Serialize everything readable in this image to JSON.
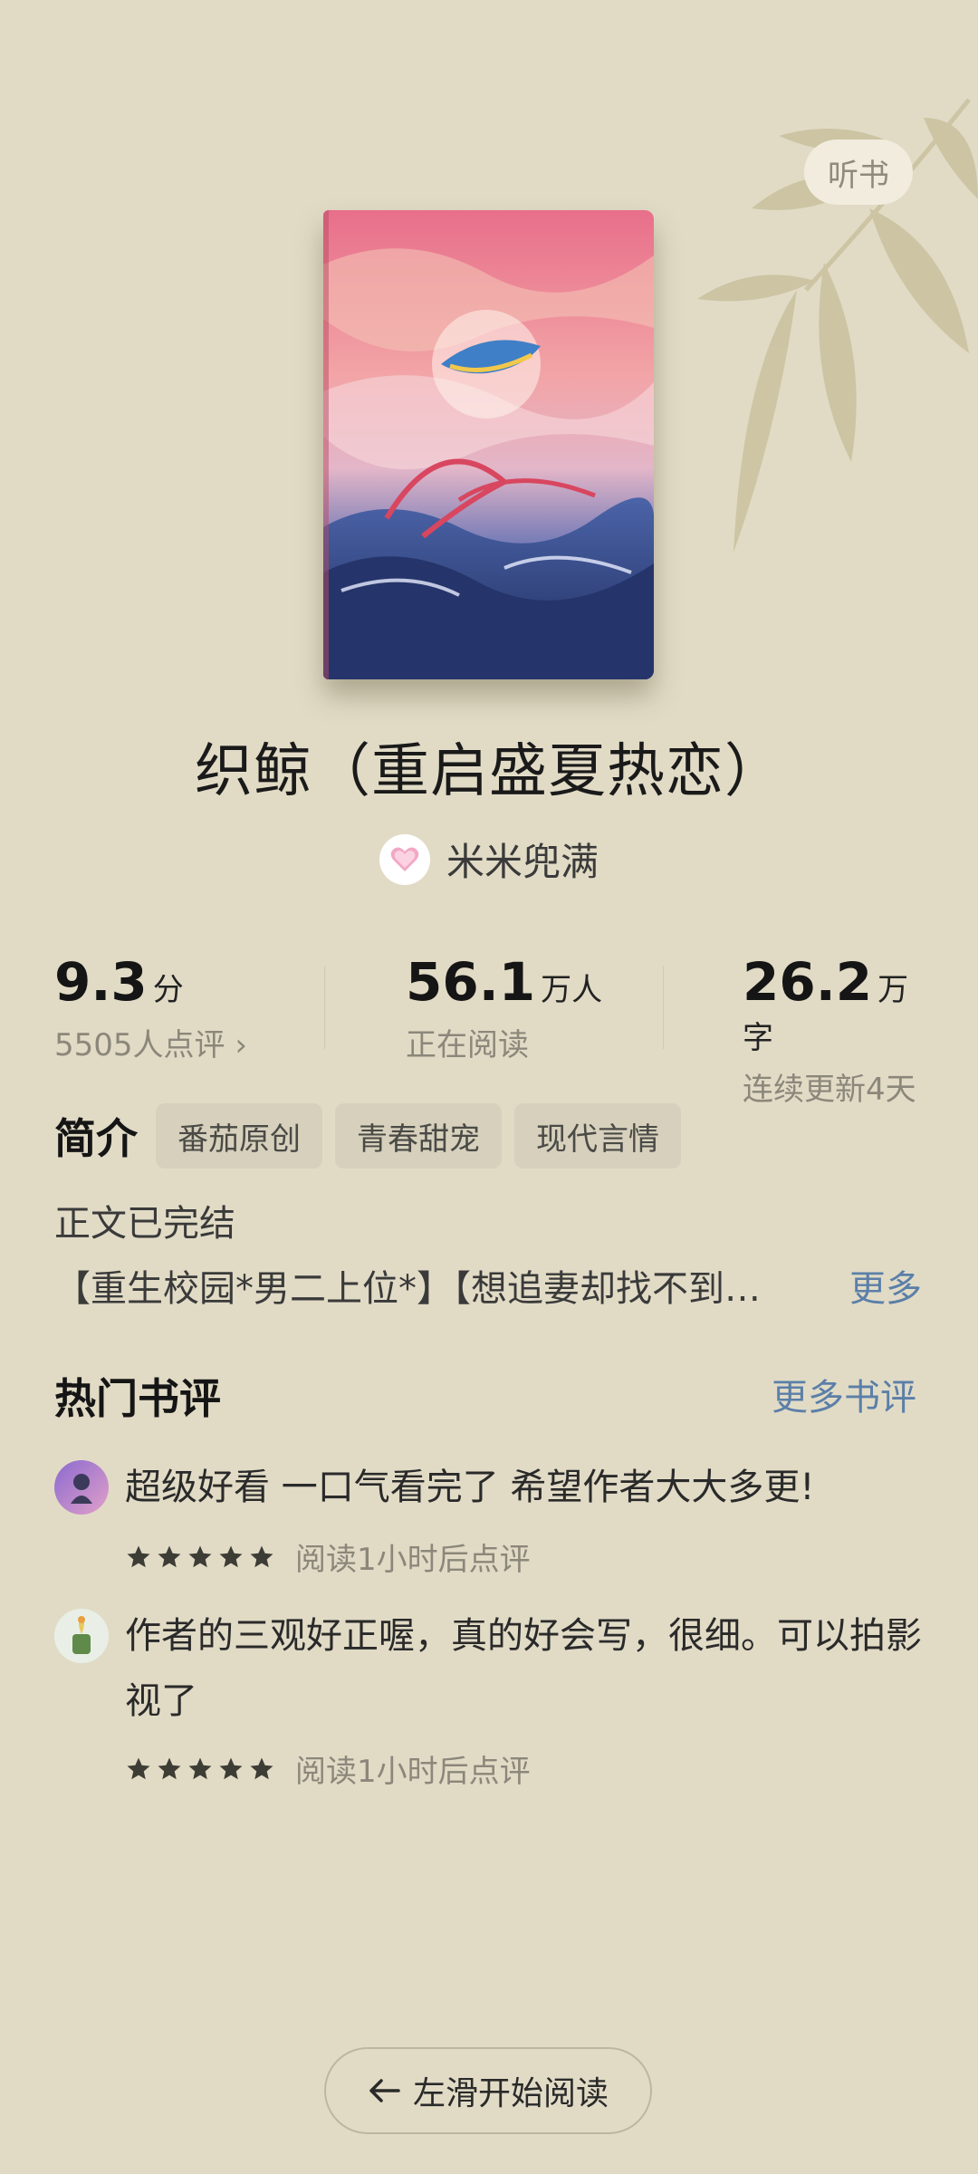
{
  "header": {
    "listen_label": "听书"
  },
  "book": {
    "title": "织鲸（重启盛夏热恋）",
    "author": "米米兜满"
  },
  "stats": [
    {
      "value": "9.3",
      "unit": "分",
      "sub": "5505人点评 ›"
    },
    {
      "value": "56.1",
      "unit": "万人",
      "sub": "正在阅读"
    },
    {
      "value": "26.2",
      "unit": "万字",
      "sub": "连续更新4天"
    }
  ],
  "intro": {
    "label": "简介",
    "tags": [
      "番茄原创",
      "青春甜宠",
      "现代言情"
    ],
    "status": "正文已完结",
    "description": "【重生校园*男二上位*】【想追妻却找不到…",
    "more_label": "更多"
  },
  "reviews_section": {
    "title": "热门书评",
    "more_label": "更多书评",
    "items": [
      {
        "text": "超级好看 一口气看完了 希望作者大大多更!",
        "rating": 5,
        "meta": "阅读1小时后点评"
      },
      {
        "text": "作者的三观好正喔，真的好会写，很细。可以拍影视了",
        "rating": 5,
        "meta": "阅读1小时后点评"
      }
    ]
  },
  "bottom": {
    "start_label": "左滑开始阅读"
  },
  "colors": {
    "background": "#e1dbc6",
    "link": "#5b7fa8",
    "tag_bg": "#d6d0bc",
    "star": "#3d3d36"
  }
}
